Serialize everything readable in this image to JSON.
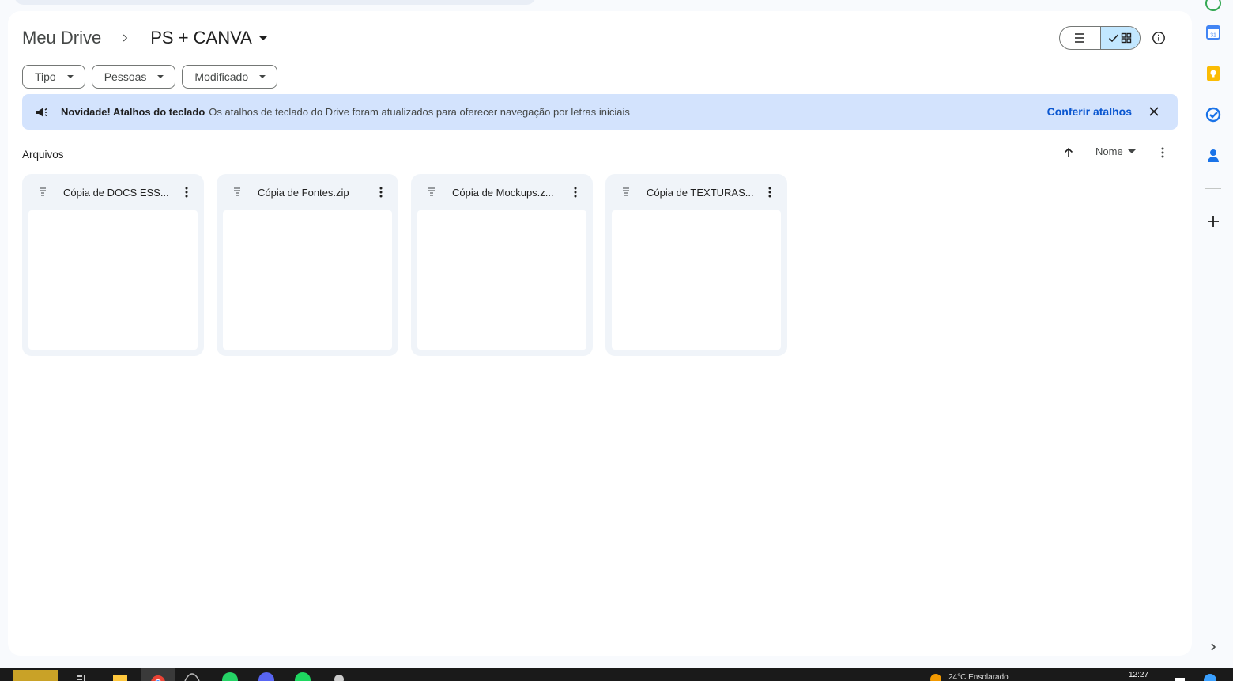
{
  "breadcrumb": {
    "root": "Meu Drive",
    "current": "PS + CANVA"
  },
  "filters": [
    {
      "label": "Tipo"
    },
    {
      "label": "Pessoas"
    },
    {
      "label": "Modificado"
    }
  ],
  "banner": {
    "title": "Novidade! Atalhos do teclado",
    "text": "Os atalhos de teclado do Drive foram atualizados para oferecer navegação por letras iniciais",
    "link": "Conferir atalhos"
  },
  "section": {
    "title": "Arquivos",
    "sort_label": "Nome"
  },
  "files": [
    {
      "name": "Cópia de DOCS ESS..."
    },
    {
      "name": "Cópia de Fontes.zip"
    },
    {
      "name": "Cópia de Mockups.z..."
    },
    {
      "name": "Cópia de TEXTURAS..."
    }
  ],
  "side_panel": {
    "calendar_day": "31",
    "icons": [
      "calendar-icon",
      "keep-icon",
      "tasks-icon",
      "contacts-icon",
      "add-icon"
    ]
  },
  "taskbar": {
    "clock": "12:27",
    "weather": "24°C  Ensolarado"
  },
  "colors": {
    "banner_bg": "#d3e3fd",
    "link": "#0b57d0",
    "active_view": "#c2e7ff",
    "card_bg": "#f0f4f9"
  }
}
